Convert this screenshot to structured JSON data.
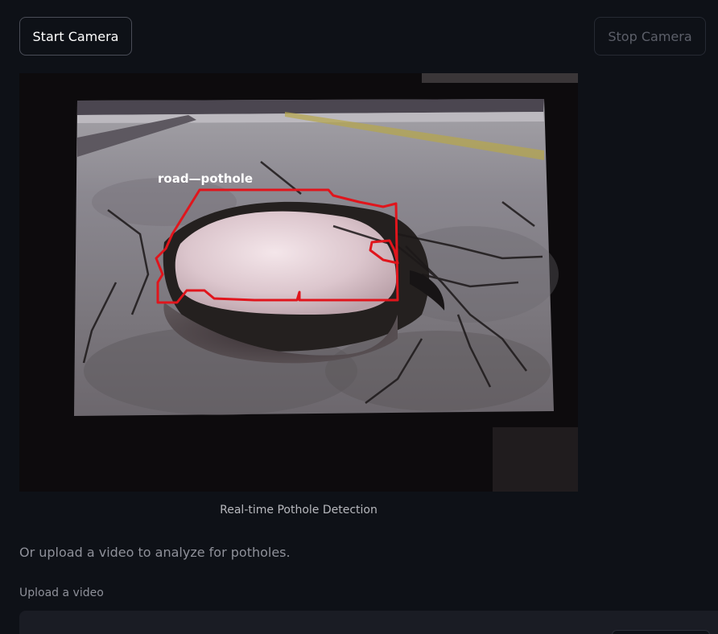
{
  "controls": {
    "start_label": "Start Camera",
    "stop_label": "Stop Camera"
  },
  "feed": {
    "detection_label": "road—pothole",
    "caption": "Real-time Pothole Detection"
  },
  "upload": {
    "hint": "Or upload a video to analyze for potholes.",
    "label": "Upload a video"
  },
  "colors": {
    "background": "#0e1117",
    "detection_outline": "#e0151c",
    "dropzone": "#1a1c24"
  }
}
